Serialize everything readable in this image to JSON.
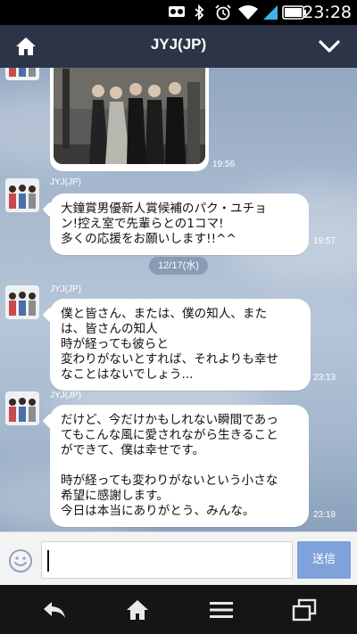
{
  "status_bar": {
    "time": "23:28"
  },
  "header": {
    "title": "JYJ(JP)"
  },
  "messages": [
    {
      "type": "image",
      "time": "19:56"
    },
    {
      "sender": "JYJ(JP)",
      "lines": [
        "大鐘賞男優新人賞候補のパク・ユチョ",
        "ン!控え室で先輩らとの1コマ!",
        "多くの応援をお願いします!!^^"
      ],
      "time": "19:57"
    },
    {
      "date_label": "12/17(水)"
    },
    {
      "sender": "JYJ(JP)",
      "lines": [
        "僕と皆さん、または、僕の知人、また",
        "は、皆さんの知人",
        "時が経っても彼らと",
        "変わりがないとすれば、それよりも幸せ",
        "なことはないでしょう..."
      ],
      "time": "23:13"
    },
    {
      "sender": "JYJ(JP)",
      "lines": [
        "だけど、今だけかもしれない瞬間であっ",
        "てもこんな風に愛されながら生きること",
        "ができて、僕は幸せです。",
        "",
        "時が経っても変わりがないという小さな",
        "希望に感謝します。",
        "今日は本当にありがとう、みんな。"
      ],
      "time": "23:18"
    }
  ],
  "input": {
    "placeholder": "",
    "send_label": "送信"
  },
  "colors": {
    "header_bg": "#2c3547",
    "send_bg": "#7ea2d9"
  },
  "icons": [
    "home-icon",
    "chevron-down-icon",
    "emoji-icon",
    "back-icon",
    "menu-icon",
    "recent-apps-icon"
  ]
}
